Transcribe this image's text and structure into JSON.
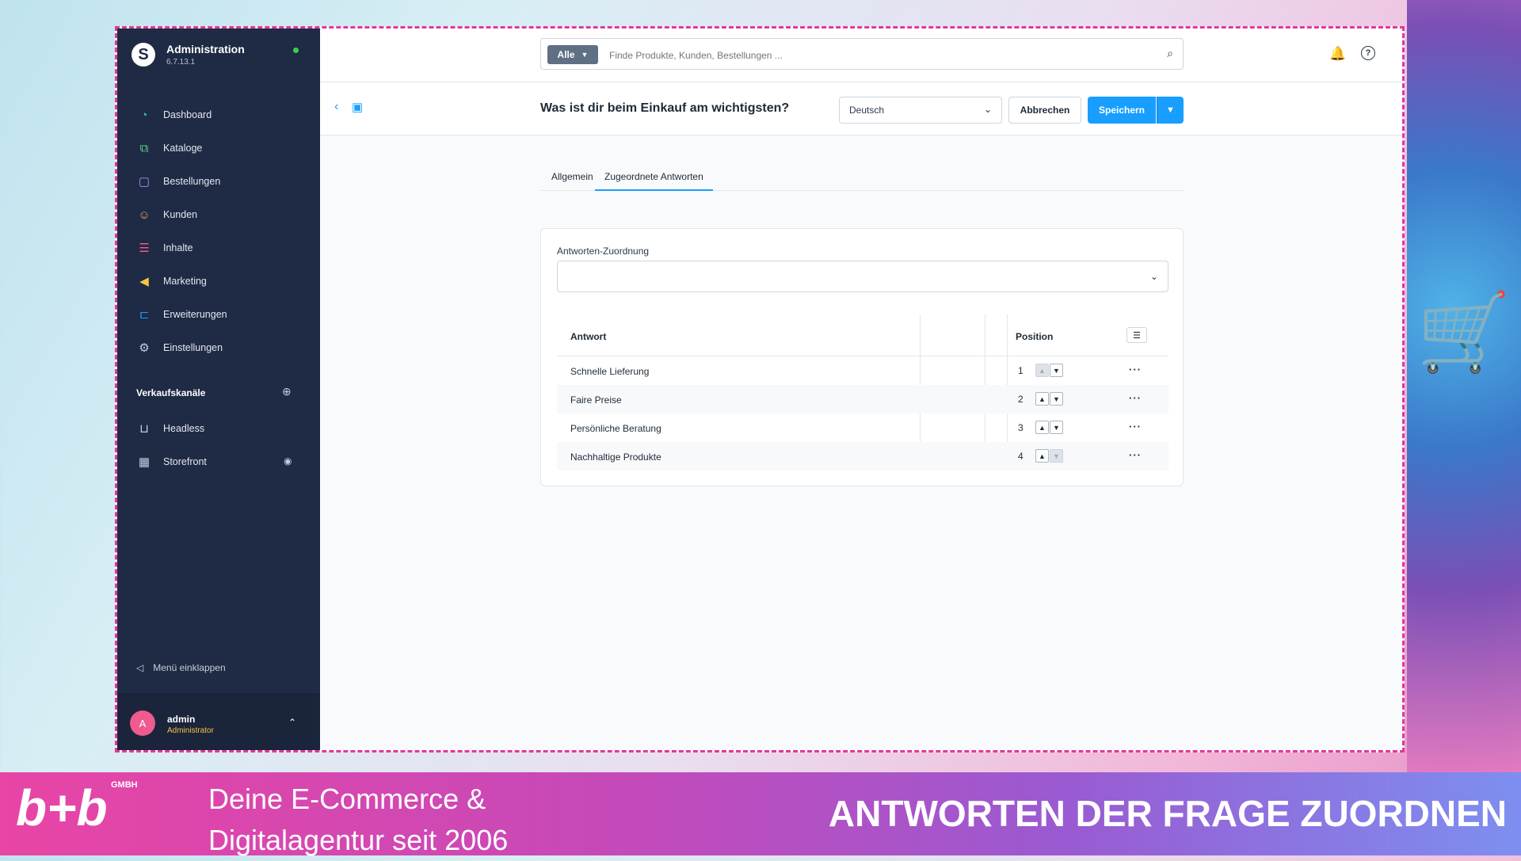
{
  "sidebar": {
    "brand_title": "Administration",
    "brand_version": "6.7.13.1",
    "nav_items": [
      {
        "label": "Dashboard",
        "icon": "gauge-icon",
        "color": "#28c2b6"
      },
      {
        "label": "Kataloge",
        "icon": "catalog-icon",
        "color": "#5bd18a"
      },
      {
        "label": "Bestellungen",
        "icon": "shopping-bag-icon",
        "color": "#a78bfa"
      },
      {
        "label": "Kunden",
        "icon": "users-icon",
        "color": "#f59e5c"
      },
      {
        "label": "Inhalte",
        "icon": "content-icon",
        "color": "#ef5a8f"
      },
      {
        "label": "Marketing",
        "icon": "megaphone-icon",
        "color": "#f5c542"
      },
      {
        "label": "Erweiterungen",
        "icon": "plug-icon",
        "color": "#189eff"
      },
      {
        "label": "Einstellungen",
        "icon": "gear-icon",
        "color": "#c6cdd9"
      }
    ],
    "sales_channels_title": "Verkaufskanäle",
    "channels": [
      {
        "label": "Headless",
        "icon": "basket-icon"
      },
      {
        "label": "Storefront",
        "icon": "storefront-icon"
      }
    ],
    "collapse_label": "Menü einklappen",
    "user": {
      "initial": "A",
      "name": "admin",
      "role": "Administrator"
    }
  },
  "topbar": {
    "search_type": "Alle",
    "search_placeholder": "Finde Produkte, Kunden, Bestellungen ..."
  },
  "smartbar": {
    "title": "Was ist dir beim Einkauf am wichtigsten?",
    "language": "Deutsch",
    "cancel_label": "Abbrechen",
    "save_label": "Speichern"
  },
  "tabs": [
    {
      "label": "Allgemein",
      "active": false
    },
    {
      "label": "Zugeordnete Antworten",
      "active": true
    }
  ],
  "card": {
    "field_label": "Antworten-Zuordnung",
    "columns": {
      "answer": "Antwort",
      "position": "Position"
    },
    "rows": [
      {
        "name": "Schnelle Lieferung",
        "position": "1"
      },
      {
        "name": "Faire Preise",
        "position": "2"
      },
      {
        "name": "Persönliche Beratung",
        "position": "3"
      },
      {
        "name": "Nachhaltige Produkte",
        "position": "4"
      }
    ]
  },
  "banner": {
    "logo": "b+b",
    "logo_suffix": "GMBH",
    "tagline_line1": "Deine E-Commerce &",
    "tagline_line2": "Digitalagentur seit 2006",
    "title": "ANTWORTEN DER FRAGE ZUORDNEN"
  },
  "colors": {
    "accent": "#189eff",
    "sidebar_bg": "#1f2a44",
    "frame_border": "#e5369a"
  }
}
